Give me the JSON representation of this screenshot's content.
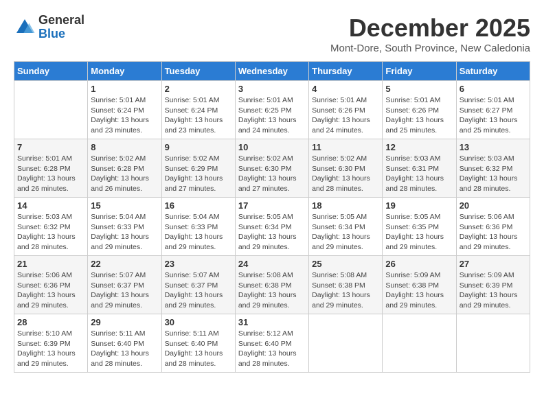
{
  "logo": {
    "general": "General",
    "blue": "Blue"
  },
  "title": "December 2025",
  "subtitle": "Mont-Dore, South Province, New Caledonia",
  "days_header": [
    "Sunday",
    "Monday",
    "Tuesday",
    "Wednesday",
    "Thursday",
    "Friday",
    "Saturday"
  ],
  "weeks": [
    [
      {
        "day": "",
        "info": ""
      },
      {
        "day": "1",
        "info": "Sunrise: 5:01 AM\nSunset: 6:24 PM\nDaylight: 13 hours\nand 23 minutes."
      },
      {
        "day": "2",
        "info": "Sunrise: 5:01 AM\nSunset: 6:24 PM\nDaylight: 13 hours\nand 23 minutes."
      },
      {
        "day": "3",
        "info": "Sunrise: 5:01 AM\nSunset: 6:25 PM\nDaylight: 13 hours\nand 24 minutes."
      },
      {
        "day": "4",
        "info": "Sunrise: 5:01 AM\nSunset: 6:26 PM\nDaylight: 13 hours\nand 24 minutes."
      },
      {
        "day": "5",
        "info": "Sunrise: 5:01 AM\nSunset: 6:26 PM\nDaylight: 13 hours\nand 25 minutes."
      },
      {
        "day": "6",
        "info": "Sunrise: 5:01 AM\nSunset: 6:27 PM\nDaylight: 13 hours\nand 25 minutes."
      }
    ],
    [
      {
        "day": "7",
        "info": "Sunrise: 5:01 AM\nSunset: 6:28 PM\nDaylight: 13 hours\nand 26 minutes."
      },
      {
        "day": "8",
        "info": "Sunrise: 5:02 AM\nSunset: 6:28 PM\nDaylight: 13 hours\nand 26 minutes."
      },
      {
        "day": "9",
        "info": "Sunrise: 5:02 AM\nSunset: 6:29 PM\nDaylight: 13 hours\nand 27 minutes."
      },
      {
        "day": "10",
        "info": "Sunrise: 5:02 AM\nSunset: 6:30 PM\nDaylight: 13 hours\nand 27 minutes."
      },
      {
        "day": "11",
        "info": "Sunrise: 5:02 AM\nSunset: 6:30 PM\nDaylight: 13 hours\nand 28 minutes."
      },
      {
        "day": "12",
        "info": "Sunrise: 5:03 AM\nSunset: 6:31 PM\nDaylight: 13 hours\nand 28 minutes."
      },
      {
        "day": "13",
        "info": "Sunrise: 5:03 AM\nSunset: 6:32 PM\nDaylight: 13 hours\nand 28 minutes."
      }
    ],
    [
      {
        "day": "14",
        "info": "Sunrise: 5:03 AM\nSunset: 6:32 PM\nDaylight: 13 hours\nand 28 minutes."
      },
      {
        "day": "15",
        "info": "Sunrise: 5:04 AM\nSunset: 6:33 PM\nDaylight: 13 hours\nand 29 minutes."
      },
      {
        "day": "16",
        "info": "Sunrise: 5:04 AM\nSunset: 6:33 PM\nDaylight: 13 hours\nand 29 minutes."
      },
      {
        "day": "17",
        "info": "Sunrise: 5:05 AM\nSunset: 6:34 PM\nDaylight: 13 hours\nand 29 minutes."
      },
      {
        "day": "18",
        "info": "Sunrise: 5:05 AM\nSunset: 6:34 PM\nDaylight: 13 hours\nand 29 minutes."
      },
      {
        "day": "19",
        "info": "Sunrise: 5:05 AM\nSunset: 6:35 PM\nDaylight: 13 hours\nand 29 minutes."
      },
      {
        "day": "20",
        "info": "Sunrise: 5:06 AM\nSunset: 6:36 PM\nDaylight: 13 hours\nand 29 minutes."
      }
    ],
    [
      {
        "day": "21",
        "info": "Sunrise: 5:06 AM\nSunset: 6:36 PM\nDaylight: 13 hours\nand 29 minutes."
      },
      {
        "day": "22",
        "info": "Sunrise: 5:07 AM\nSunset: 6:37 PM\nDaylight: 13 hours\nand 29 minutes."
      },
      {
        "day": "23",
        "info": "Sunrise: 5:07 AM\nSunset: 6:37 PM\nDaylight: 13 hours\nand 29 minutes."
      },
      {
        "day": "24",
        "info": "Sunrise: 5:08 AM\nSunset: 6:38 PM\nDaylight: 13 hours\nand 29 minutes."
      },
      {
        "day": "25",
        "info": "Sunrise: 5:08 AM\nSunset: 6:38 PM\nDaylight: 13 hours\nand 29 minutes."
      },
      {
        "day": "26",
        "info": "Sunrise: 5:09 AM\nSunset: 6:38 PM\nDaylight: 13 hours\nand 29 minutes."
      },
      {
        "day": "27",
        "info": "Sunrise: 5:09 AM\nSunset: 6:39 PM\nDaylight: 13 hours\nand 29 minutes."
      }
    ],
    [
      {
        "day": "28",
        "info": "Sunrise: 5:10 AM\nSunset: 6:39 PM\nDaylight: 13 hours\nand 29 minutes."
      },
      {
        "day": "29",
        "info": "Sunrise: 5:11 AM\nSunset: 6:40 PM\nDaylight: 13 hours\nand 28 minutes."
      },
      {
        "day": "30",
        "info": "Sunrise: 5:11 AM\nSunset: 6:40 PM\nDaylight: 13 hours\nand 28 minutes."
      },
      {
        "day": "31",
        "info": "Sunrise: 5:12 AM\nSunset: 6:40 PM\nDaylight: 13 hours\nand 28 minutes."
      },
      {
        "day": "",
        "info": ""
      },
      {
        "day": "",
        "info": ""
      },
      {
        "day": "",
        "info": ""
      }
    ]
  ]
}
